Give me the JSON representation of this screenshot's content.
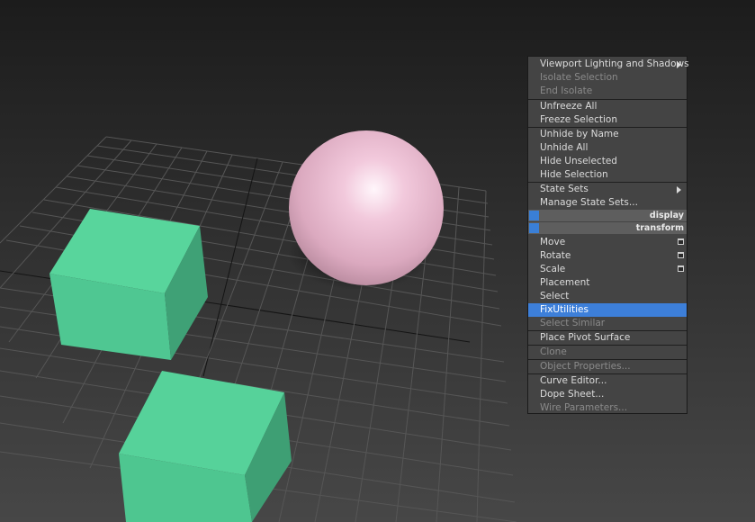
{
  "viewport": {
    "objects": [
      "box",
      "box",
      "sphere"
    ],
    "colors": {
      "box": "#4fcc94",
      "sphere": "#e6b3c8",
      "grid": "#545454",
      "grid_axis": "#111111"
    }
  },
  "quad_menu": {
    "display_quadrant": {
      "header": "display",
      "items": [
        {
          "label": "Viewport Lighting and Shadows",
          "enabled": true,
          "submenu": true
        },
        {
          "label": "Isolate Selection",
          "enabled": false
        },
        {
          "label": "End Isolate",
          "enabled": false
        },
        {
          "label": "Unfreeze All",
          "enabled": true
        },
        {
          "label": "Freeze Selection",
          "enabled": true
        },
        {
          "label": "Unhide by Name",
          "enabled": true
        },
        {
          "label": "Unhide All",
          "enabled": true
        },
        {
          "label": "Hide Unselected",
          "enabled": true
        },
        {
          "label": "Hide Selection",
          "enabled": true
        },
        {
          "label": "State Sets",
          "enabled": true,
          "submenu": true
        },
        {
          "label": "Manage State Sets...",
          "enabled": true
        }
      ]
    },
    "transform_quadrant": {
      "header": "transform",
      "items": [
        {
          "label": "Move",
          "enabled": true,
          "options_box": true
        },
        {
          "label": "Rotate",
          "enabled": true,
          "options_box": true
        },
        {
          "label": "Scale",
          "enabled": true,
          "options_box": true
        },
        {
          "label": "Placement",
          "enabled": true
        },
        {
          "label": "Select",
          "enabled": true
        },
        {
          "label": "FixUtilities",
          "enabled": true,
          "highlighted": true
        },
        {
          "label": "Select Similar",
          "enabled": false
        },
        {
          "label": "Place Pivot Surface",
          "enabled": true
        },
        {
          "label": "Clone",
          "enabled": false
        },
        {
          "label": "Object Properties...",
          "enabled": false
        },
        {
          "label": "Curve Editor...",
          "enabled": true
        },
        {
          "label": "Dope Sheet...",
          "enabled": true
        },
        {
          "label": "Wire Parameters...",
          "enabled": false
        }
      ]
    },
    "colors": {
      "menu_bg": "#444444",
      "highlight": "#3d7fd9",
      "header_bg": "#5e5e5e",
      "quad_accent": "#3a7fd6"
    }
  }
}
